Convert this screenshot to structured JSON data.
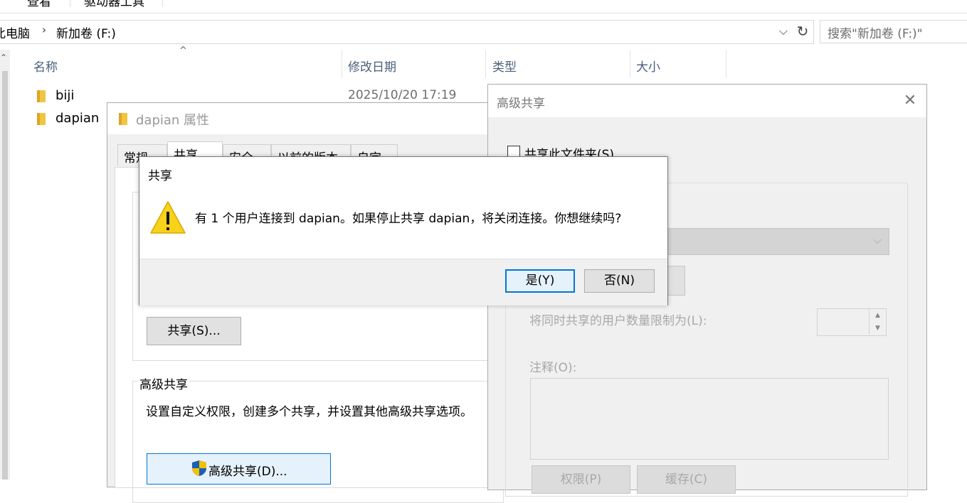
{
  "ribbon": {
    "tabs": [
      "查看",
      "驱动器工具"
    ]
  },
  "address_bar": {
    "crumbs": [
      "此电脑",
      "新加卷 (F:)"
    ],
    "search_placeholder": "搜索\"新加卷 (F:)\""
  },
  "file_list": {
    "columns": [
      "名称",
      "修改日期",
      "类型",
      "大小"
    ],
    "rows": [
      {
        "name": "biji",
        "date": "2025/10/20 17:19"
      },
      {
        "name": "dapian",
        "date": ""
      }
    ]
  },
  "properties_dialog": {
    "title": "dapian 属性",
    "tabs": [
      "常规",
      "共享",
      "安全",
      "以前的版本",
      "自定义"
    ],
    "share_button": "共享(S)...",
    "advanced_group_title": "高级共享",
    "advanced_desc": "设置自定义权限，创建多个共享，并设置其他高级共享选项。",
    "advanced_button": "高级共享(D)..."
  },
  "advanced_dialog": {
    "title": "高级共享",
    "share_checkbox_label": "共享此文件夹(S)",
    "user_limit_label": "将同时共享的用户数量限制为(L):",
    "comment_label": "注释(O):",
    "permissions_button": "权限(P)",
    "cache_button": "缓存(C)"
  },
  "confirm_dialog": {
    "title": "共享",
    "message": "有 1 个用户连接到 dapian。如果停止共享 dapian，将关闭连接。你想继续吗?",
    "yes_button": "是(Y)",
    "no_button": "否(N)"
  },
  "icons": {
    "warning": "warning-icon",
    "folder": "folder-icon",
    "shield": "uac-shield-icon",
    "close": "close-icon",
    "refresh": "refresh-icon"
  },
  "colors": {
    "accent": "#0078d7",
    "header_text": "#4c607a",
    "disabled_text": "#a8a8a8",
    "dialog_bg": "#f0f0f0",
    "warning_yellow": "#f7d21b"
  }
}
